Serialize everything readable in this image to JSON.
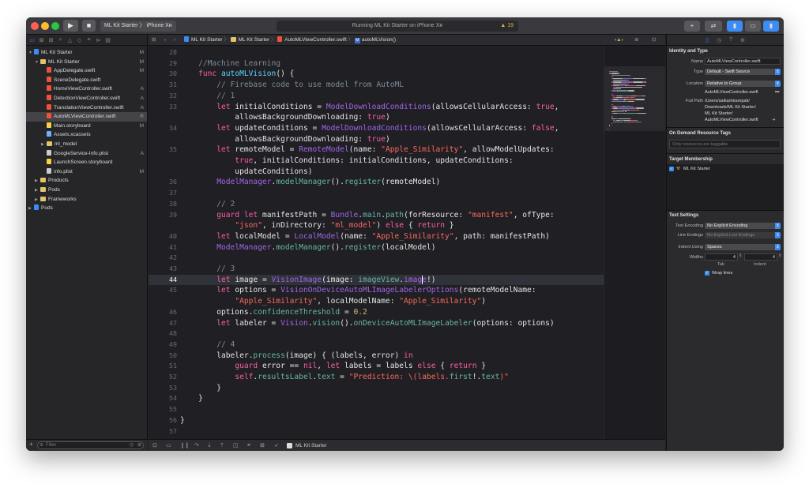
{
  "toolbar": {
    "scheme": "ML Kit Starter",
    "device": "iPhone Xʀ",
    "status": "Running ML Kit Starter on iPhone Xʀ",
    "warnings": "19",
    "play_icon": "▶",
    "stop_icon": "■"
  },
  "navigator": {
    "items": [
      {
        "label": "ML Kit Starter",
        "status": "M",
        "depth": 0,
        "kind": "proj",
        "tri": "▼"
      },
      {
        "label": "ML Kit Starter",
        "status": "M",
        "depth": 1,
        "kind": "folder",
        "tri": "▼"
      },
      {
        "label": "AppDelegate.swift",
        "status": "M",
        "depth": 2,
        "kind": "swift",
        "tri": ""
      },
      {
        "label": "SceneDelegate.swift",
        "status": "",
        "depth": 2,
        "kind": "swift",
        "tri": ""
      },
      {
        "label": "HomeViewController.swift",
        "status": "A",
        "depth": 2,
        "kind": "swift",
        "tri": ""
      },
      {
        "label": "DetectionViewController.swift",
        "status": "A",
        "depth": 2,
        "kind": "swift",
        "tri": ""
      },
      {
        "label": "TranslationViewController.swift",
        "status": "A",
        "depth": 2,
        "kind": "swift",
        "tri": ""
      },
      {
        "label": "AutoMLViewController.swift",
        "status": "R",
        "depth": 2,
        "kind": "swift",
        "tri": "",
        "selected": true
      },
      {
        "label": "Main.storyboard",
        "status": "M",
        "depth": 2,
        "kind": "sb",
        "tri": ""
      },
      {
        "label": "Assets.xcassets",
        "status": "",
        "depth": 2,
        "kind": "asset",
        "tri": ""
      },
      {
        "label": "ml_model",
        "status": "",
        "depth": 2,
        "kind": "folder",
        "tri": "▶"
      },
      {
        "label": "GoogleService-Info.plist",
        "status": "A",
        "depth": 2,
        "kind": "plist",
        "tri": ""
      },
      {
        "label": "LaunchScreen.storyboard",
        "status": "",
        "depth": 2,
        "kind": "sb",
        "tri": ""
      },
      {
        "label": "info.plist",
        "status": "M",
        "depth": 2,
        "kind": "plist",
        "tri": ""
      },
      {
        "label": "Products",
        "status": "",
        "depth": 1,
        "kind": "folder",
        "tri": "▶"
      },
      {
        "label": "Pods",
        "status": "",
        "depth": 1,
        "kind": "folder",
        "tri": "▶"
      },
      {
        "label": "Frameworks",
        "status": "",
        "depth": 1,
        "kind": "folder",
        "tri": "▶"
      },
      {
        "label": "Pods",
        "status": "",
        "depth": 0,
        "kind": "proj",
        "tri": "▶"
      }
    ],
    "filter_placeholder": "Filter"
  },
  "jumpbar": {
    "crumbs": [
      "ML Kit Starter",
      "ML Kit Starter",
      "AutoMLViewController.swift",
      "autoMLVision()"
    ]
  },
  "editor": {
    "current_line": 44,
    "lines": [
      {
        "n": "28",
        "s": []
      },
      {
        "n": "29",
        "s": [
          [
            "    ",
            ""
          ],
          [
            "//Machine Learning",
            "c"
          ]
        ]
      },
      {
        "n": "30",
        "s": [
          [
            "    ",
            ""
          ],
          [
            "func",
            "k"
          ],
          [
            " ",
            ""
          ],
          [
            "autoMLVision",
            "t"
          ],
          [
            "() {",
            ""
          ]
        ]
      },
      {
        "n": "31",
        "s": [
          [
            "        ",
            ""
          ],
          [
            "// Firebase code to use model from AutoML",
            "c"
          ]
        ]
      },
      {
        "n": "32",
        "s": [
          [
            "        ",
            ""
          ],
          [
            "// 1",
            "c"
          ]
        ]
      },
      {
        "n": "33",
        "s": [
          [
            "        ",
            ""
          ],
          [
            "let",
            "k"
          ],
          [
            " initialConditions = ",
            ""
          ],
          [
            "ModelDownloadConditions",
            "p"
          ],
          [
            "(allowsCellularAccess: ",
            ""
          ],
          [
            "true",
            "k"
          ],
          [
            ",",
            ""
          ]
        ]
      },
      {
        "n": "",
        "s": [
          [
            "            allowsBackgroundDownloading: ",
            ""
          ],
          [
            "true",
            "k"
          ],
          [
            ")",
            ""
          ]
        ]
      },
      {
        "n": "34",
        "s": [
          [
            "        ",
            ""
          ],
          [
            "let",
            "k"
          ],
          [
            " updateConditions = ",
            ""
          ],
          [
            "ModelDownloadConditions",
            "p"
          ],
          [
            "(allowsCellularAccess: ",
            ""
          ],
          [
            "false",
            "k"
          ],
          [
            ",",
            ""
          ]
        ]
      },
      {
        "n": "",
        "s": [
          [
            "            allowsBackgroundDownloading: ",
            ""
          ],
          [
            "true",
            "k"
          ],
          [
            ")",
            ""
          ]
        ]
      },
      {
        "n": "35",
        "s": [
          [
            "        ",
            ""
          ],
          [
            "let",
            "k"
          ],
          [
            " remoteModel = ",
            ""
          ],
          [
            "RemoteModel",
            "p"
          ],
          [
            "(name: ",
            ""
          ],
          [
            "\"Apple_Similarity\"",
            "s"
          ],
          [
            ", allowModelUpdates:",
            ""
          ]
        ]
      },
      {
        "n": "",
        "s": [
          [
            "            ",
            ""
          ],
          [
            "true",
            "k"
          ],
          [
            ", initialConditions: initialConditions, updateConditions:",
            ""
          ]
        ]
      },
      {
        "n": "",
        "s": [
          [
            "            updateConditions)",
            ""
          ]
        ]
      },
      {
        "n": "36",
        "s": [
          [
            "        ",
            ""
          ],
          [
            "ModelManager",
            "p"
          ],
          [
            ".",
            ""
          ],
          [
            "modelManager",
            "f"
          ],
          [
            "().",
            ""
          ],
          [
            "register",
            "f"
          ],
          [
            "(remoteModel)",
            ""
          ]
        ]
      },
      {
        "n": "37",
        "s": []
      },
      {
        "n": "38",
        "s": [
          [
            "        ",
            ""
          ],
          [
            "// 2",
            "c"
          ]
        ]
      },
      {
        "n": "39",
        "s": [
          [
            "        ",
            ""
          ],
          [
            "guard",
            "k"
          ],
          [
            " ",
            ""
          ],
          [
            "let",
            "k"
          ],
          [
            " manifestPath = ",
            ""
          ],
          [
            "Bundle",
            "p"
          ],
          [
            ".",
            ""
          ],
          [
            "main",
            "f"
          ],
          [
            ".",
            ""
          ],
          [
            "path",
            "f"
          ],
          [
            "(forResource: ",
            ""
          ],
          [
            "\"manifest\"",
            "s"
          ],
          [
            ", ofType:",
            ""
          ]
        ]
      },
      {
        "n": "",
        "s": [
          [
            "            ",
            ""
          ],
          [
            "\"json\"",
            "s"
          ],
          [
            ", inDirectory: ",
            ""
          ],
          [
            "\"ml_model\"",
            "s"
          ],
          [
            ") ",
            ""
          ],
          [
            "else",
            "k"
          ],
          [
            " { ",
            ""
          ],
          [
            "return",
            "k"
          ],
          [
            " }",
            ""
          ]
        ]
      },
      {
        "n": "40",
        "s": [
          [
            "        ",
            ""
          ],
          [
            "let",
            "k"
          ],
          [
            " localModel = ",
            ""
          ],
          [
            "LocalModel",
            "p"
          ],
          [
            "(name: ",
            ""
          ],
          [
            "\"Apple_Similarity\"",
            "s"
          ],
          [
            ", path: manifestPath)",
            ""
          ]
        ]
      },
      {
        "n": "41",
        "s": [
          [
            "        ",
            ""
          ],
          [
            "ModelManager",
            "p"
          ],
          [
            ".",
            ""
          ],
          [
            "modelManager",
            "f"
          ],
          [
            "().",
            ""
          ],
          [
            "register",
            "f"
          ],
          [
            "(localModel)",
            ""
          ]
        ]
      },
      {
        "n": "42",
        "s": []
      },
      {
        "n": "43",
        "s": [
          [
            "        ",
            ""
          ],
          [
            "// 3",
            "c"
          ]
        ]
      },
      {
        "n": "44",
        "s": [
          [
            "        ",
            ""
          ],
          [
            "let",
            "k"
          ],
          [
            " image = ",
            ""
          ],
          [
            "VisionImage",
            "p"
          ],
          [
            "(image: ",
            ""
          ],
          [
            "imageView",
            "f"
          ],
          [
            ".",
            ""
          ],
          [
            "image",
            "p"
          ],
          [
            "!)",
            ""
          ]
        ]
      },
      {
        "n": "45",
        "s": [
          [
            "        ",
            ""
          ],
          [
            "let",
            "k"
          ],
          [
            " options = ",
            ""
          ],
          [
            "VisionOnDeviceAutoMLImageLabelerOptions",
            "p"
          ],
          [
            "(remoteModelName:",
            ""
          ]
        ]
      },
      {
        "n": "",
        "s": [
          [
            "            ",
            ""
          ],
          [
            "\"Apple_Similarity\"",
            "s"
          ],
          [
            ", localModelName: ",
            ""
          ],
          [
            "\"Apple_Similarity\"",
            "s"
          ],
          [
            ")",
            ""
          ]
        ]
      },
      {
        "n": "46",
        "s": [
          [
            "        options.",
            ""
          ],
          [
            "confidenceThreshold",
            "f"
          ],
          [
            " = ",
            ""
          ],
          [
            "0.2",
            "n"
          ]
        ]
      },
      {
        "n": "47",
        "s": [
          [
            "        ",
            ""
          ],
          [
            "let",
            "k"
          ],
          [
            " labeler = ",
            ""
          ],
          [
            "Vision",
            "p"
          ],
          [
            ".",
            ""
          ],
          [
            "vision",
            "f"
          ],
          [
            "().",
            ""
          ],
          [
            "onDeviceAutoMLImageLabeler",
            "f"
          ],
          [
            "(options: options)",
            ""
          ]
        ]
      },
      {
        "n": "48",
        "s": []
      },
      {
        "n": "49",
        "s": [
          [
            "        ",
            ""
          ],
          [
            "// 4",
            "c"
          ]
        ]
      },
      {
        "n": "50",
        "s": [
          [
            "        labeler.",
            ""
          ],
          [
            "process",
            "f"
          ],
          [
            "(image) { (labels, error) ",
            ""
          ],
          [
            "in",
            "k"
          ]
        ]
      },
      {
        "n": "51",
        "s": [
          [
            "            ",
            ""
          ],
          [
            "guard",
            "k"
          ],
          [
            " error == ",
            ""
          ],
          [
            "nil",
            "k"
          ],
          [
            ", ",
            ""
          ],
          [
            "let",
            "k"
          ],
          [
            " labels = labels ",
            ""
          ],
          [
            "else",
            "k"
          ],
          [
            " { ",
            ""
          ],
          [
            "return",
            "k"
          ],
          [
            " }",
            ""
          ]
        ]
      },
      {
        "n": "52",
        "s": [
          [
            "            ",
            ""
          ],
          [
            "self",
            "k"
          ],
          [
            ".",
            ""
          ],
          [
            "resultsLabel",
            "f"
          ],
          [
            ".",
            ""
          ],
          [
            "text",
            "f"
          ],
          [
            " = ",
            ""
          ],
          [
            "\"Prediction: \\(labels.",
            "s"
          ],
          [
            "first",
            "f"
          ],
          [
            "!.",
            ""
          ],
          [
            "text",
            "f"
          ],
          [
            ")\"",
            "s"
          ]
        ]
      },
      {
        "n": "53",
        "s": [
          [
            "        }",
            ""
          ]
        ]
      },
      {
        "n": "54",
        "s": [
          [
            "    }",
            ""
          ]
        ]
      },
      {
        "n": "55",
        "s": []
      },
      {
        "n": "56",
        "s": [
          [
            "}",
            ""
          ]
        ]
      },
      {
        "n": "57",
        "s": []
      }
    ]
  },
  "debugbar": {
    "target": "ML Kit Starter"
  },
  "inspector": {
    "identity_header": "Identity and Type",
    "name_label": "Name",
    "name_value": "AutoMLViewController.swift",
    "type_label": "Type",
    "type_value": "Default - Swift Source",
    "location_label": "Location",
    "location_value": "Relative to Group",
    "location_file": "AutoMLViewController.swift",
    "fullpath_label": "Full Path",
    "fullpath_lines": [
      "/Users/saikambampati/",
      "Downloads/ML Kit Starter/",
      "ML Kit Starter/",
      "AutoMLViewController.swift"
    ],
    "odr_header": "On Demand Resource Tags",
    "odr_placeholder": "Only resources are taggable",
    "target_header": "Target Membership",
    "target_item": "ML Kit Starter",
    "text_header": "Text Settings",
    "encoding_label": "Text Encoding",
    "encoding_value": "No Explicit Encoding",
    "endings_label": "Line Endings",
    "endings_value": "No Explicit Line Endings",
    "indent_label": "Indent Using",
    "indent_value": "Spaces",
    "widths_label": "Widths",
    "tab_value": "4",
    "indent_width_value": "4",
    "tab_label": "Tab",
    "indent_sub_label": "Indent",
    "wrap_label": "Wrap lines"
  },
  "colors": {
    "accent": "#3b8cf4",
    "keyword": "#fc5fa3",
    "comment": "#7f8c98",
    "string": "#fc6a5d",
    "number": "#d0bf69",
    "type": "#a167e6",
    "function": "#67b7a4",
    "declaration": "#5dd8ff"
  }
}
